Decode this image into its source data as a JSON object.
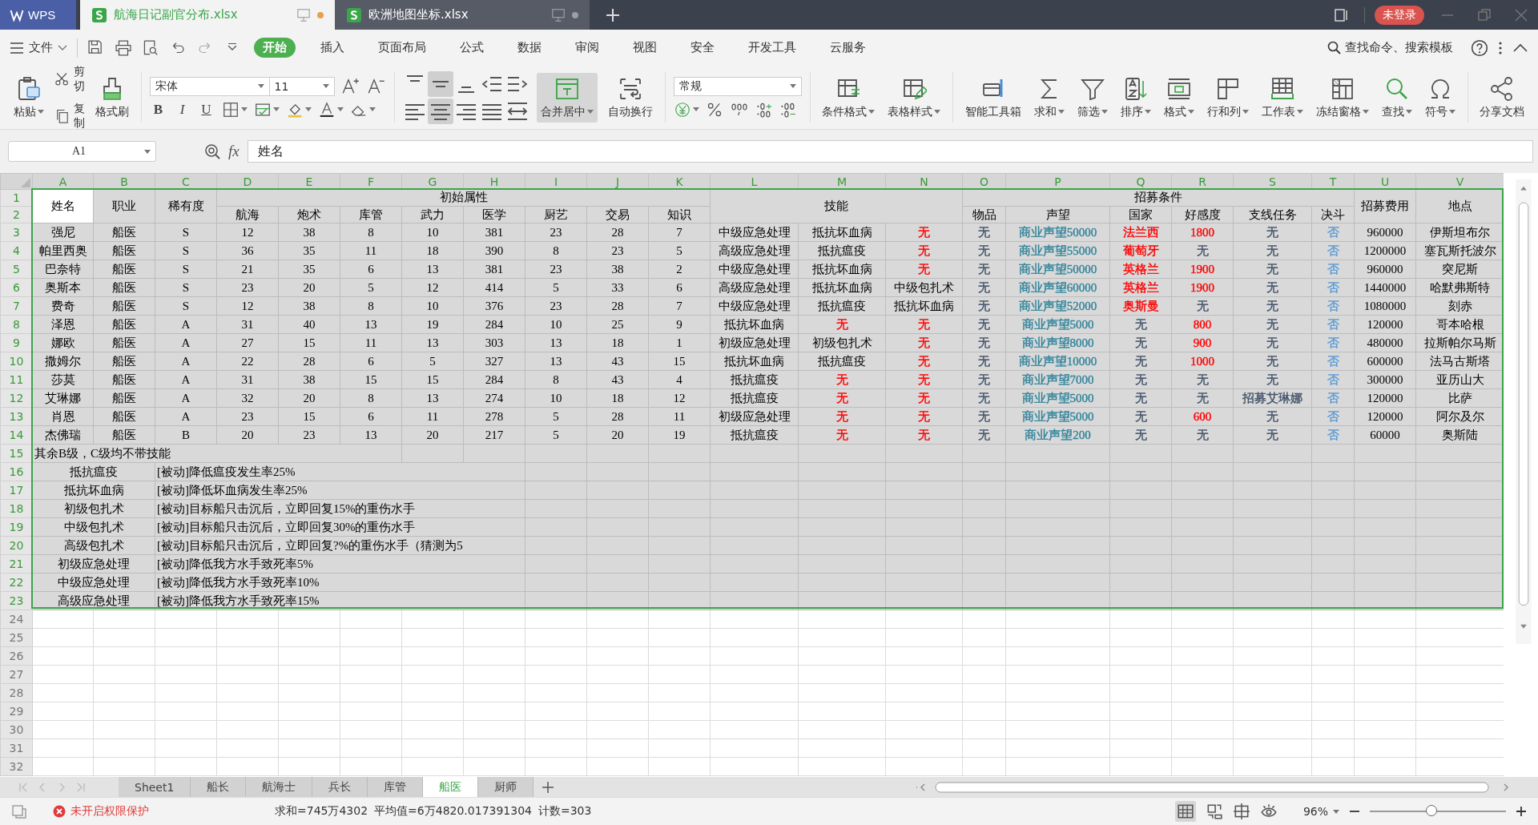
{
  "titlebar": {
    "app": "WPS",
    "tabs": [
      {
        "title": "航海日记副官分布.xlsx",
        "selected": true,
        "modified": true
      },
      {
        "title": "欧洲地图坐标.xlsx",
        "selected": false,
        "modified": false
      }
    ],
    "login": "未登录"
  },
  "menu": {
    "file": "文件",
    "tabs": [
      {
        "label": "开始",
        "selected": true
      },
      {
        "label": "插入",
        "selected": false
      },
      {
        "label": "页面布局",
        "selected": false
      },
      {
        "label": "公式",
        "selected": false
      },
      {
        "label": "数据",
        "selected": false
      },
      {
        "label": "审阅",
        "selected": false
      },
      {
        "label": "视图",
        "selected": false
      },
      {
        "label": "安全",
        "selected": false
      },
      {
        "label": "开发工具",
        "selected": false
      },
      {
        "label": "云服务",
        "selected": false
      }
    ],
    "search": "查找命令、搜索模板"
  },
  "ribbon": {
    "paste": {
      "label": "粘贴",
      "dropdown": true
    },
    "cut": "剪切",
    "copy": "复制",
    "painter": "格式刷",
    "font": "宋体",
    "font_size": "11",
    "styles": [
      "B",
      "I",
      "U"
    ],
    "alignment": [
      {
        "pressed": false
      },
      {
        "pressed": true
      },
      {
        "pressed": false
      },
      {
        "pressed": false
      },
      {
        "pressed": false
      },
      {
        "pressed": false
      },
      {
        "pressed": true
      },
      {
        "pressed": false
      },
      {
        "pressed": false
      },
      {
        "pressed": false
      }
    ],
    "merge": {
      "label": "合并居中",
      "dropdown": true,
      "pressed": true
    },
    "wrap": "自动换行",
    "number_format": "常规",
    "tool_groups": [
      [
        {
          "label": "条件格式",
          "dropdown": true
        },
        {
          "label": "表格样式",
          "dropdown": true
        }
      ],
      [
        {
          "label": "智能工具箱",
          "dropdown": false
        },
        {
          "label": "求和",
          "dropdown": true
        },
        {
          "label": "筛选",
          "dropdown": true
        },
        {
          "label": "排序",
          "dropdown": true
        },
        {
          "label": "格式",
          "dropdown": true
        },
        {
          "label": "行和列",
          "dropdown": true
        },
        {
          "label": "工作表",
          "dropdown": true
        },
        {
          "label": "冻结窗格",
          "dropdown": true
        },
        {
          "label": "查找",
          "dropdown": true
        },
        {
          "label": "符号",
          "dropdown": true
        }
      ]
    ],
    "share": "分享文档"
  },
  "formula": {
    "cell": "A1",
    "fx": "fx",
    "value": "姓名"
  },
  "sheet": {
    "columns": [
      {
        "label": "A",
        "selected": true
      },
      {
        "label": "B",
        "selected": true
      },
      {
        "label": "C",
        "selected": true
      },
      {
        "label": "D",
        "selected": true
      },
      {
        "label": "E",
        "selected": true
      },
      {
        "label": "F",
        "selected": true
      },
      {
        "label": "G",
        "selected": true
      },
      {
        "label": "H",
        "selected": true
      },
      {
        "label": "I",
        "selected": true
      },
      {
        "label": "J",
        "selected": true
      },
      {
        "label": "K",
        "selected": true
      },
      {
        "label": "L",
        "selected": true
      },
      {
        "label": "M",
        "selected": true
      },
      {
        "label": "N",
        "selected": true
      },
      {
        "label": "O",
        "selected": true
      },
      {
        "label": "P",
        "selected": true
      },
      {
        "label": "Q",
        "selected": true
      },
      {
        "label": "R",
        "selected": true
      },
      {
        "label": "S",
        "selected": true
      },
      {
        "label": "T",
        "selected": true
      },
      {
        "label": "U",
        "selected": true
      },
      {
        "label": "V",
        "selected": true
      }
    ],
    "rows": [
      {
        "label": "1",
        "selected": true,
        "kind": "header",
        "cells": [
          {
            "text": "姓名",
            "active": true
          },
          {
            "text": "职业",
            "active": false
          },
          {
            "text": "稀有度",
            "active": false
          },
          {
            "text": "初始属性",
            "active": false
          },
          {
            "text": "技能",
            "active": false
          },
          {
            "text": "招募条件",
            "active": false
          },
          {
            "text": "招募费用",
            "active": false
          },
          {
            "text": "地点",
            "active": false
          }
        ]
      },
      {
        "label": "2",
        "selected": true,
        "kind": "header",
        "cells": [
          {
            "text": "航海",
            "active": false
          },
          {
            "text": "炮术",
            "active": false
          },
          {
            "text": "库管",
            "active": false
          },
          {
            "text": "武力",
            "active": false
          },
          {
            "text": "医学",
            "active": false
          },
          {
            "text": "厨艺",
            "active": false
          },
          {
            "text": "交易",
            "active": false
          },
          {
            "text": "知识",
            "active": false
          },
          {
            "text": "物品",
            "active": false
          },
          {
            "text": "声望",
            "active": false
          },
          {
            "text": "国家",
            "active": false
          },
          {
            "text": "好感度",
            "active": false
          },
          {
            "text": "支线任务",
            "active": false
          },
          {
            "text": "决斗",
            "active": false
          }
        ]
      },
      {
        "label": "3",
        "selected": true,
        "kind": "record",
        "cells": [
          "强尼",
          "船医",
          "S",
          "12",
          "38",
          "8",
          "10",
          "381",
          "23",
          "28",
          "7",
          "中级应急处理",
          "抵抗坏血病",
          {
            "text": "无",
            "color": "#ff0000"
          },
          {
            "text": "无",
            "color": "#44546a"
          },
          {
            "text": "商业声望50000",
            "color": "#31849b"
          },
          {
            "text": "法兰西",
            "color": "#ff0000"
          },
          {
            "text": "1800",
            "color": "#ff0000"
          },
          {
            "text": "无",
            "color": "#44546a"
          },
          {
            "text": "否",
            "color": "#5b9bd5"
          },
          "960000",
          "伊斯坦布尔"
        ]
      },
      {
        "label": "4",
        "selected": true,
        "kind": "record",
        "cells": [
          "帕里西奥",
          "船医",
          "S",
          "36",
          "35",
          "11",
          "18",
          "390",
          "8",
          "23",
          "5",
          "高级应急处理",
          "抵抗瘟疫",
          {
            "text": "无",
            "color": "#ff0000"
          },
          {
            "text": "无",
            "color": "#44546a"
          },
          {
            "text": "商业声望55000",
            "color": "#31849b"
          },
          {
            "text": "葡萄牙",
            "color": "#ff0000"
          },
          {
            "text": "无",
            "color": "#44546a"
          },
          {
            "text": "无",
            "color": "#44546a"
          },
          {
            "text": "否",
            "color": "#5b9bd5"
          },
          "1200000",
          "塞瓦斯托波尔"
        ]
      },
      {
        "label": "5",
        "selected": true,
        "kind": "record",
        "cells": [
          "巴奈特",
          "船医",
          "S",
          "21",
          "35",
          "6",
          "13",
          "381",
          "23",
          "38",
          "2",
          "中级应急处理",
          "抵抗坏血病",
          {
            "text": "无",
            "color": "#ff0000"
          },
          {
            "text": "无",
            "color": "#44546a"
          },
          {
            "text": "商业声望50000",
            "color": "#31849b"
          },
          {
            "text": "英格兰",
            "color": "#ff0000"
          },
          {
            "text": "1900",
            "color": "#ff0000"
          },
          {
            "text": "无",
            "color": "#44546a"
          },
          {
            "text": "否",
            "color": "#5b9bd5"
          },
          "960000",
          "突尼斯"
        ]
      },
      {
        "label": "6",
        "selected": true,
        "kind": "record",
        "cells": [
          "奥斯本",
          "船医",
          "S",
          "23",
          "20",
          "5",
          "12",
          "414",
          "5",
          "33",
          "6",
          "高级应急处理",
          "抵抗坏血病",
          "中级包扎术",
          {
            "text": "无",
            "color": "#44546a"
          },
          {
            "text": "商业声望60000",
            "color": "#31849b"
          },
          {
            "text": "英格兰",
            "color": "#ff0000"
          },
          {
            "text": "1900",
            "color": "#ff0000"
          },
          {
            "text": "无",
            "color": "#44546a"
          },
          {
            "text": "否",
            "color": "#5b9bd5"
          },
          "1440000",
          "哈默弗斯特"
        ]
      },
      {
        "label": "7",
        "selected": true,
        "kind": "record",
        "cells": [
          "费奇",
          "船医",
          "S",
          "12",
          "38",
          "8",
          "10",
          "376",
          "23",
          "28",
          "7",
          "中级应急处理",
          "抵抗瘟疫",
          "抵抗坏血病",
          {
            "text": "无",
            "color": "#44546a"
          },
          {
            "text": "商业声望52000",
            "color": "#31849b"
          },
          {
            "text": "奥斯曼",
            "color": "#ff0000"
          },
          {
            "text": "无",
            "color": "#44546a"
          },
          {
            "text": "无",
            "color": "#44546a"
          },
          {
            "text": "否",
            "color": "#5b9bd5"
          },
          "1080000",
          "刻赤"
        ]
      },
      {
        "label": "8",
        "selected": true,
        "kind": "record",
        "cells": [
          "泽恩",
          "船医",
          "A",
          "31",
          "40",
          "13",
          "19",
          "284",
          "10",
          "25",
          "9",
          "抵抗坏血病",
          {
            "text": "无",
            "color": "#ff0000"
          },
          {
            "text": "无",
            "color": "#ff0000"
          },
          {
            "text": "无",
            "color": "#44546a"
          },
          {
            "text": "商业声望5000",
            "color": "#31849b"
          },
          {
            "text": "无",
            "color": "#44546a"
          },
          {
            "text": "800",
            "color": "#ff0000"
          },
          {
            "text": "无",
            "color": "#44546a"
          },
          {
            "text": "否",
            "color": "#5b9bd5"
          },
          "120000",
          "哥本哈根"
        ]
      },
      {
        "label": "9",
        "selected": true,
        "kind": "record",
        "cells": [
          "娜欧",
          "船医",
          "A",
          "27",
          "15",
          "11",
          "13",
          "303",
          "13",
          "18",
          "1",
          "初级应急处理",
          "初级包扎术",
          {
            "text": "无",
            "color": "#ff0000"
          },
          {
            "text": "无",
            "color": "#44546a"
          },
          {
            "text": "商业声望8000",
            "color": "#31849b"
          },
          {
            "text": "无",
            "color": "#44546a"
          },
          {
            "text": "900",
            "color": "#ff0000"
          },
          {
            "text": "无",
            "color": "#44546a"
          },
          {
            "text": "否",
            "color": "#5b9bd5"
          },
          "480000",
          "拉斯帕尔马斯"
        ]
      },
      {
        "label": "10",
        "selected": true,
        "kind": "record",
        "cells": [
          "撒姆尔",
          "船医",
          "A",
          "22",
          "28",
          "6",
          "5",
          "327",
          "13",
          "43",
          "15",
          "抵抗坏血病",
          "抵抗瘟疫",
          {
            "text": "无",
            "color": "#ff0000"
          },
          {
            "text": "无",
            "color": "#44546a"
          },
          {
            "text": "商业声望10000",
            "color": "#31849b"
          },
          {
            "text": "无",
            "color": "#44546a"
          },
          {
            "text": "1000",
            "color": "#ff0000"
          },
          {
            "text": "无",
            "color": "#44546a"
          },
          {
            "text": "否",
            "color": "#5b9bd5"
          },
          "600000",
          "法马古斯塔"
        ]
      },
      {
        "label": "11",
        "selected": true,
        "kind": "record",
        "cells": [
          "莎莫",
          "船医",
          "A",
          "31",
          "38",
          "15",
          "15",
          "284",
          "8",
          "43",
          "4",
          "抵抗瘟疫",
          {
            "text": "无",
            "color": "#ff0000"
          },
          {
            "text": "无",
            "color": "#ff0000"
          },
          {
            "text": "无",
            "color": "#44546a"
          },
          {
            "text": "商业声望7000",
            "color": "#31849b"
          },
          {
            "text": "无",
            "color": "#44546a"
          },
          {
            "text": "无",
            "color": "#44546a"
          },
          {
            "text": "无",
            "color": "#44546a"
          },
          {
            "text": "否",
            "color": "#5b9bd5"
          },
          "300000",
          "亚历山大"
        ]
      },
      {
        "label": "12",
        "selected": true,
        "kind": "record",
        "cells": [
          "艾琳娜",
          "船医",
          "A",
          "32",
          "20",
          "8",
          "13",
          "274",
          "10",
          "18",
          "12",
          "抵抗瘟疫",
          {
            "text": "无",
            "color": "#ff0000"
          },
          {
            "text": "无",
            "color": "#ff0000"
          },
          {
            "text": "无",
            "color": "#44546a"
          },
          {
            "text": "商业声望5000",
            "color": "#31849b"
          },
          {
            "text": "无",
            "color": "#44546a"
          },
          {
            "text": "无",
            "color": "#44546a"
          },
          {
            "text": "招募艾琳娜",
            "color": "#44546a"
          },
          {
            "text": "否",
            "color": "#5b9bd5"
          },
          "120000",
          "比萨"
        ]
      },
      {
        "label": "13",
        "selected": true,
        "kind": "record",
        "cells": [
          "肖恩",
          "船医",
          "A",
          "23",
          "15",
          "6",
          "11",
          "278",
          "5",
          "28",
          "11",
          "初级应急处理",
          {
            "text": "无",
            "color": "#ff0000"
          },
          {
            "text": "无",
            "color": "#ff0000"
          },
          {
            "text": "无",
            "color": "#44546a"
          },
          {
            "text": "商业声望5000",
            "color": "#31849b"
          },
          {
            "text": "无",
            "color": "#44546a"
          },
          {
            "text": "600",
            "color": "#ff0000"
          },
          {
            "text": "无",
            "color": "#44546a"
          },
          {
            "text": "否",
            "color": "#5b9bd5"
          },
          "120000",
          "阿尔及尔"
        ]
      },
      {
        "label": "14",
        "selected": true,
        "kind": "record",
        "cells": [
          "杰佛瑞",
          "船医",
          "B",
          "20",
          "23",
          "13",
          "20",
          "217",
          "5",
          "20",
          "19",
          "抵抗瘟疫",
          {
            "text": "无",
            "color": "#ff0000"
          },
          {
            "text": "无",
            "color": "#ff0000"
          },
          {
            "text": "无",
            "color": "#44546a"
          },
          {
            "text": "商业声望200",
            "color": "#31849b"
          },
          {
            "text": "无",
            "color": "#44546a"
          },
          {
            "text": "无",
            "color": "#44546a"
          },
          {
            "text": "无",
            "color": "#44546a"
          },
          {
            "text": "否",
            "color": "#5b9bd5"
          },
          "60000",
          "奥斯陆"
        ]
      },
      {
        "label": "15",
        "selected": true,
        "kind": "note",
        "cells": [
          "其余B级，C级均不带技能"
        ]
      },
      {
        "label": "16",
        "selected": true,
        "kind": "skill",
        "cells": [
          "抵抗瘟疫",
          "[被动]降低瘟疫发生率25%"
        ]
      },
      {
        "label": "17",
        "selected": true,
        "kind": "skill",
        "cells": [
          "抵抗坏血病",
          "[被动]降低坏血病发生率25%"
        ]
      },
      {
        "label": "18",
        "selected": true,
        "kind": "skill",
        "cells": [
          "初级包扎术",
          "[被动]目标船只击沉后，立即回复15%的重伤水手"
        ]
      },
      {
        "label": "19",
        "selected": true,
        "kind": "skill",
        "cells": [
          "中级包扎术",
          "[被动]目标船只击沉后，立即回复30%的重伤水手"
        ]
      },
      {
        "label": "20",
        "selected": true,
        "kind": "skill",
        "cells": [
          "高级包扎术",
          "[被动]目标船只击沉后，立即回复?%的重伤水手（猜测为5"
        ]
      },
      {
        "label": "21",
        "selected": true,
        "kind": "skill",
        "cells": [
          "初级应急处理",
          "[被动]降低我方水手致死率5%"
        ]
      },
      {
        "label": "22",
        "selected": true,
        "kind": "skill",
        "cells": [
          "中级应急处理",
          "[被动]降低我方水手致死率10%"
        ]
      },
      {
        "label": "23",
        "selected": true,
        "kind": "skill",
        "cells": [
          "高级应急处理",
          "[被动]降低我方水手致死率15%"
        ]
      },
      {
        "label": "24",
        "selected": false,
        "kind": "empty"
      },
      {
        "label": "25",
        "selected": false,
        "kind": "empty"
      },
      {
        "label": "26",
        "selected": false,
        "kind": "empty"
      },
      {
        "label": "27",
        "selected": false,
        "kind": "empty"
      },
      {
        "label": "28",
        "selected": false,
        "kind": "empty"
      },
      {
        "label": "29",
        "selected": false,
        "kind": "empty"
      },
      {
        "label": "30",
        "selected": false,
        "kind": "empty"
      },
      {
        "label": "31",
        "selected": false,
        "kind": "empty"
      },
      {
        "label": "32",
        "selected": false,
        "kind": "empty"
      }
    ]
  },
  "sheet_tabs": [
    {
      "label": "Sheet1",
      "selected": false
    },
    {
      "label": "船长",
      "selected": false
    },
    {
      "label": "航海士",
      "selected": false
    },
    {
      "label": "兵长",
      "selected": false
    },
    {
      "label": "库管",
      "selected": false
    },
    {
      "label": "船医",
      "selected": true
    },
    {
      "label": "厨师",
      "selected": false
    }
  ],
  "status": {
    "protection": "未开启权限保护",
    "sum": "求和=745万4302",
    "average": "平均值=6万4820.017391304",
    "count": "计数=303",
    "zoom": "96%",
    "zoom_slider": {
      "level": 0.46
    }
  }
}
